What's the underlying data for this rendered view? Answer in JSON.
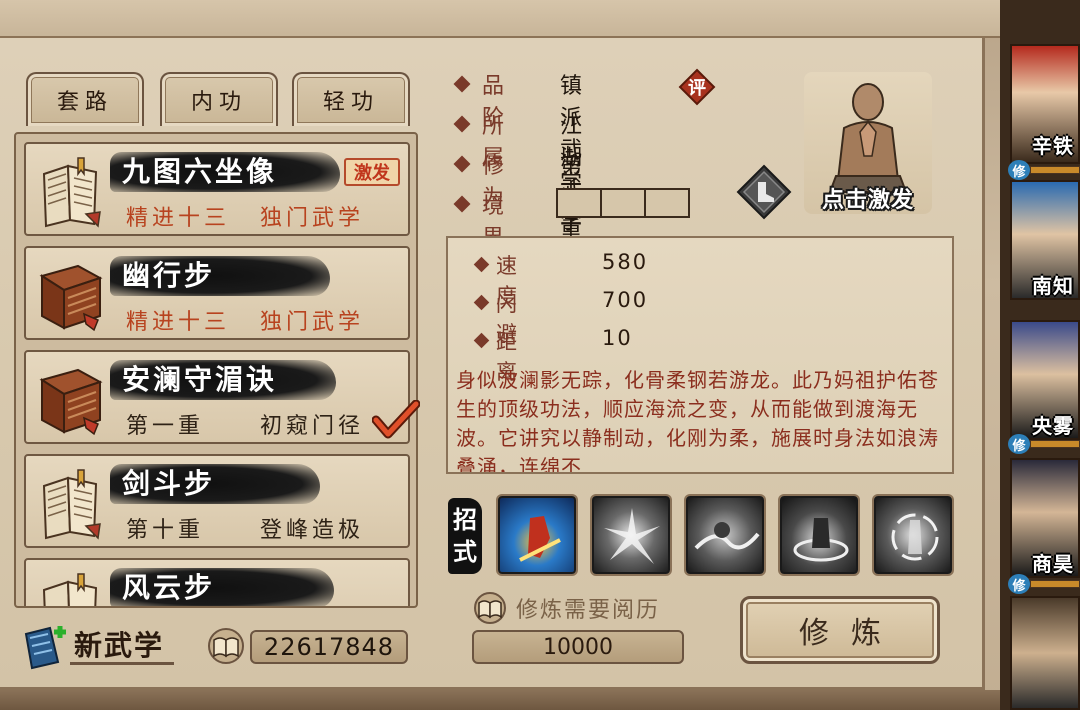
{
  "tabs": [
    "套路",
    "内功",
    "轻功"
  ],
  "skills": [
    {
      "name": "九图六坐像",
      "badge": "激发",
      "sub1": "精进十三",
      "sub2": "独门武学",
      "sub_color": "red"
    },
    {
      "name": "幽行步",
      "badge": "",
      "sub1": "精进十三",
      "sub2": "独门武学",
      "sub_color": "red"
    },
    {
      "name": "安澜守湄诀",
      "badge": "",
      "sub1": "第一重",
      "sub2": "初窥门径",
      "sub_color": "dark",
      "checked": true
    },
    {
      "name": "剑斗步",
      "badge": "",
      "sub1": "第十重",
      "sub2": "登峰造极",
      "sub_color": "dark"
    },
    {
      "name": "风云步",
      "badge": "",
      "sub1": "",
      "sub2": "",
      "sub_color": "dark"
    }
  ],
  "new_skill_label": "新武学",
  "points": "22617848",
  "info": {
    "rank_label": "品阶",
    "rank_value": "镇派武学",
    "rank_badge": "评",
    "belong_label": "所属",
    "belong_value": "江湖武学",
    "level_label": "修为",
    "level_value": "第一重(三)",
    "realm_label": "境界"
  },
  "portrait_label": "点击激发",
  "stats": [
    {
      "label": "速度",
      "value": "580"
    },
    {
      "label": "闪避",
      "value": "700"
    },
    {
      "label": "距离",
      "value": "10"
    }
  ],
  "description": "身似波澜影无踪，化骨柔钢若游龙。此乃妈祖护佑苍生的顶级功法，顺应海流之变，从而能做到渡海无波。它讲究以静制动，化刚为柔，施展时身法如浪涛叠涌，连绵不",
  "moves_label": [
    "招",
    "式"
  ],
  "requirement_label": "修炼需要阅历",
  "requirement_value": "10000",
  "cultivate_label": "修炼",
  "characters": [
    {
      "name": "辛铁",
      "badge": "修"
    },
    {
      "name": "南知",
      "badge": ""
    },
    {
      "name": "央雾",
      "badge": "修"
    },
    {
      "name": "商昊",
      "badge": "修"
    },
    {
      "name": "",
      "badge": ""
    }
  ],
  "colors": {
    "accent_red": "#b8431f",
    "label_brown": "#7a3a2a",
    "badge_blue": "#2d7fb8"
  }
}
